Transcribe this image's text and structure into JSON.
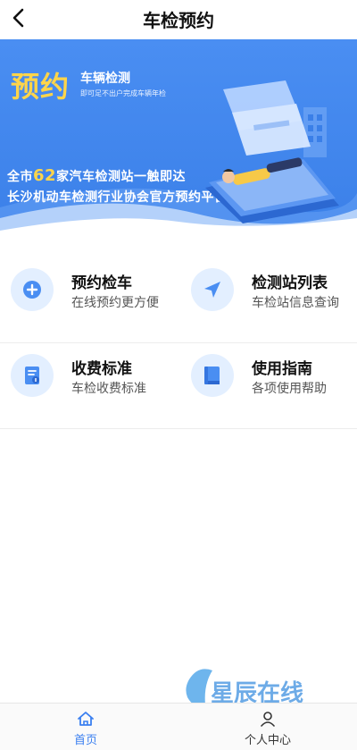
{
  "header": {
    "title": "车检预约",
    "back_icon": "chevron-left-icon"
  },
  "banner": {
    "badge_main": "预约",
    "badge_sub": "车辆检测",
    "badge_note": "即可足不出户完成车辆年检",
    "slogan1_prefix": "全市",
    "slogan1_number": "62",
    "slogan1_suffix": "家汽车检测站一触即达",
    "slogan2": "长沙机动车检测行业协会官方预约平台"
  },
  "menu": [
    {
      "icon": "plus-icon",
      "title": "预约检车",
      "subtitle": "在线预约更方便"
    },
    {
      "icon": "navigation-arrow-icon",
      "title": "检测站列表",
      "subtitle": "车检站信息查询"
    },
    {
      "icon": "document-fee-icon",
      "title": "收费标准",
      "subtitle": "车检收费标准"
    },
    {
      "icon": "book-icon",
      "title": "使用指南",
      "subtitle": "各项使用帮助"
    }
  ],
  "bottom_nav": [
    {
      "label": "首页",
      "icon": "home-icon",
      "active": true
    },
    {
      "label": "个人中心",
      "icon": "user-icon",
      "active": false
    }
  ],
  "watermark": {
    "text": "星辰在线"
  },
  "colors": {
    "accent": "#3a7ff0",
    "banner": "#4a8ef2",
    "highlight": "#ffd54a",
    "icon_bg": "#e3efff"
  }
}
